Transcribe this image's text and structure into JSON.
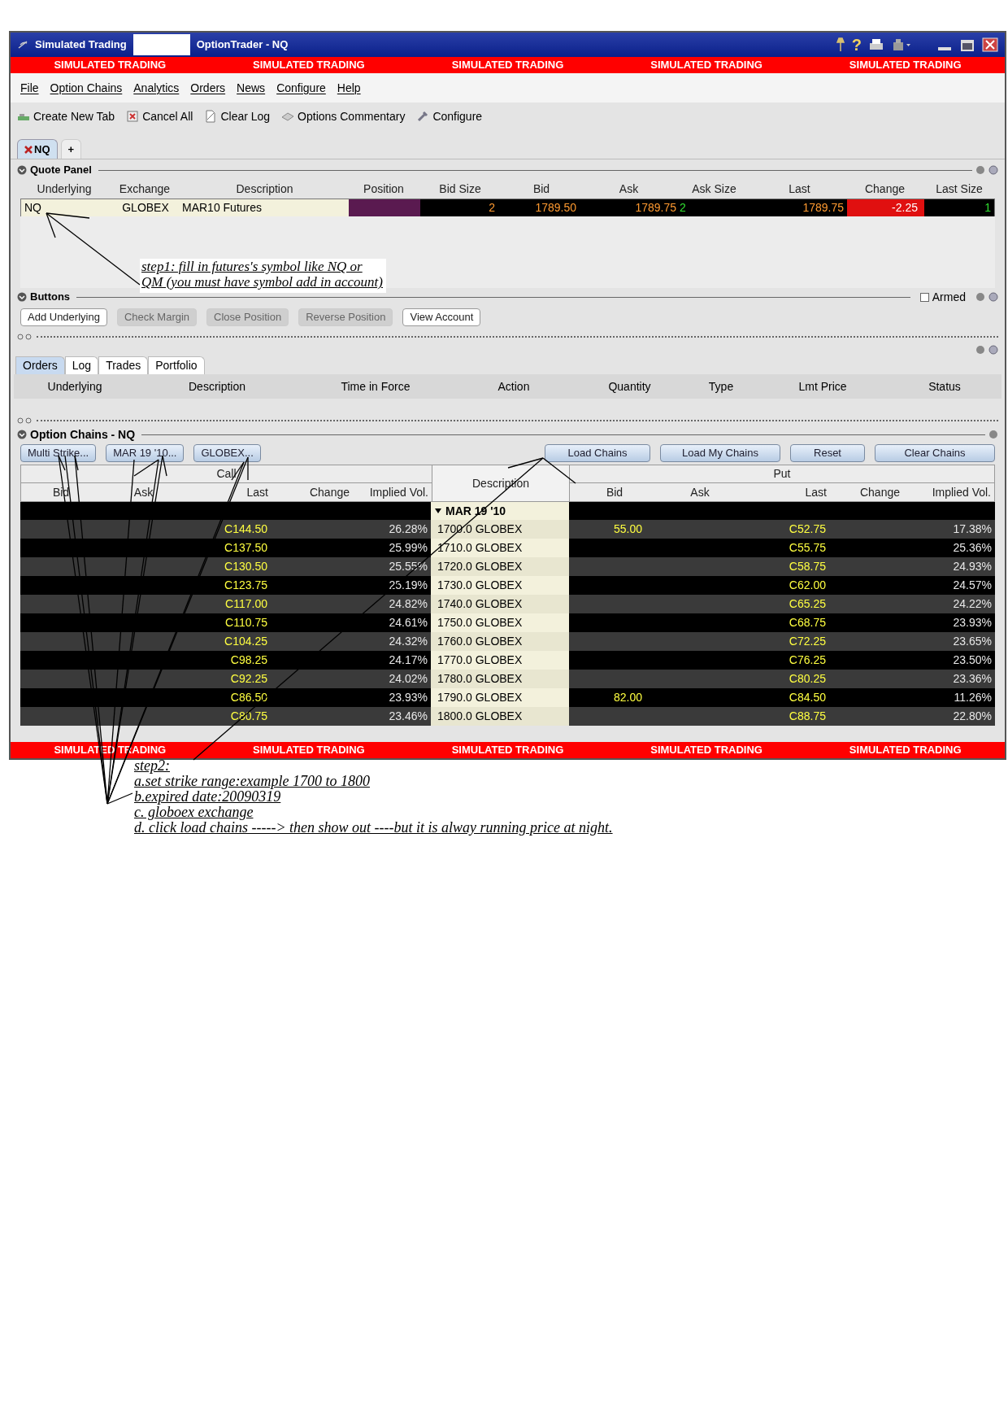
{
  "window": {
    "title_start": "Simulated Trading",
    "title_end": "OptionTrader - NQ",
    "help_glyph": "?"
  },
  "banner_top": [
    "SIMULATED TRADING",
    "SIMULATED TRADING",
    "SIMULATED TRADING",
    "SIMULATED TRADING",
    "SIMULATED TRADING"
  ],
  "menu": [
    "File",
    "Option Chains",
    "Analytics",
    "Orders",
    "News",
    "Configure",
    "Help"
  ],
  "toolbar": [
    "Create New Tab",
    "Cancel All",
    "Clear Log",
    "Options Commentary",
    "Configure"
  ],
  "page_tabs": [
    {
      "label": "NQ",
      "selected": true
    },
    {
      "label": "+",
      "selected": false
    }
  ],
  "quote_panel": {
    "title": "Quote Panel",
    "columns": [
      "Underlying",
      "Exchange",
      "Description",
      "Position",
      "Bid Size",
      "Bid",
      "Ask",
      "Ask Size",
      "Last",
      "Change",
      "Last Size"
    ],
    "row": {
      "underlying": "NQ",
      "exchange": "GLOBEX",
      "description": "MAR10 Futures",
      "bid_size": "2",
      "bid": "1789.50",
      "ask": "1789.75",
      "ask_size": "2",
      "last": "1789.75",
      "change": "-2.25",
      "last_size": "1"
    }
  },
  "buttons_panel": {
    "title": "Buttons",
    "armed": {
      "label": "Armed",
      "checked": false
    },
    "buttons": [
      {
        "label": "Add Underlying",
        "disabled": false
      },
      {
        "label": "Check Margin",
        "disabled": true
      },
      {
        "label": "Close Position",
        "disabled": true
      },
      {
        "label": "Reverse Position",
        "disabled": true
      },
      {
        "label": "View Account",
        "disabled": false
      }
    ]
  },
  "orders_panel": {
    "tabs": [
      {
        "label": "Orders",
        "selected": true
      },
      {
        "label": "Log",
        "selected": false
      },
      {
        "label": "Trades",
        "selected": false
      },
      {
        "label": "Portfolio",
        "selected": false
      }
    ],
    "columns": [
      "Underlying",
      "Description",
      "Time in Force",
      "Action",
      "Quantity",
      "Type",
      "Lmt Price",
      "Status"
    ]
  },
  "option_chains": {
    "title": "Option Chains - NQ",
    "left_buttons": [
      "Multi Strike...",
      "MAR 19 '10...",
      "GLOBEX..."
    ],
    "right_buttons": [
      "Load Chains",
      "Load My Chains",
      "Reset",
      "Clear Chains"
    ],
    "call_label": "Call",
    "put_label": "Put",
    "description_label": "Description",
    "call_columns": [
      "Bid",
      "Ask",
      "Last",
      "Change",
      "Implied Vol."
    ],
    "put_columns": [
      "Bid",
      "Ask",
      "Last",
      "Change",
      "Implied Vol."
    ],
    "expiry": {
      "label": "MAR 19 '10",
      "expanded": true
    },
    "rows": [
      {
        "call": {
          "last": "C144.50",
          "iv": "26.28%"
        },
        "strike": "1700.0 GLOBEX",
        "put": {
          "bid": "55.00",
          "last": "C52.75",
          "iv": "17.38%"
        }
      },
      {
        "call": {
          "last": "C137.50",
          "iv": "25.99%"
        },
        "strike": "1710.0 GLOBEX",
        "put": {
          "last": "C55.75",
          "iv": "25.36%"
        }
      },
      {
        "call": {
          "last": "C130.50",
          "iv": "25.55%"
        },
        "strike": "1720.0 GLOBEX",
        "put": {
          "last": "C58.75",
          "iv": "24.93%"
        }
      },
      {
        "call": {
          "last": "C123.75",
          "iv": "25.19%"
        },
        "strike": "1730.0 GLOBEX",
        "put": {
          "last": "C62.00",
          "iv": "24.57%"
        }
      },
      {
        "call": {
          "last": "C117.00",
          "iv": "24.82%"
        },
        "strike": "1740.0 GLOBEX",
        "put": {
          "last": "C65.25",
          "iv": "24.22%"
        }
      },
      {
        "call": {
          "last": "C110.75",
          "iv": "24.61%"
        },
        "strike": "1750.0 GLOBEX",
        "put": {
          "last": "C68.75",
          "iv": "23.93%"
        }
      },
      {
        "call": {
          "last": "C104.25",
          "iv": "24.32%"
        },
        "strike": "1760.0 GLOBEX",
        "put": {
          "last": "C72.25",
          "iv": "23.65%"
        }
      },
      {
        "call": {
          "last": "C98.25",
          "iv": "24.17%"
        },
        "strike": "1770.0 GLOBEX",
        "put": {
          "last": "C76.25",
          "iv": "23.50%"
        }
      },
      {
        "call": {
          "last": "C92.25",
          "iv": "24.02%"
        },
        "strike": "1780.0 GLOBEX",
        "put": {
          "last": "C80.25",
          "iv": "23.36%"
        }
      },
      {
        "call": {
          "last": "C86.50",
          "iv": "23.93%"
        },
        "strike": "1790.0 GLOBEX",
        "put": {
          "bid": "82.00",
          "last": "C84.50",
          "iv": "11.26%"
        }
      },
      {
        "call": {
          "last": "C80.75",
          "iv": "23.46%"
        },
        "strike": "1800.0 GLOBEX",
        "put": {
          "last": "C88.75",
          "iv": "22.80%"
        }
      }
    ]
  },
  "banner_bottom": [
    "SIMULATED TRADING",
    "SIMULATED TRADING",
    "SIMULATED TRADING",
    "SIMULATED TRADING",
    "SIMULATED TRADING"
  ],
  "note_step1": [
    "step1: fill in futures's symbol like NQ or",
    "QM (you must have symbol add in account)"
  ],
  "note_step2": [
    "step2:",
    "a.set strike range:example 1700 to 1800",
    "b.expired date:20090319",
    "c. globoex exchange",
    "d. click load chains -----> then show out ----but it is alway running price at night."
  ]
}
